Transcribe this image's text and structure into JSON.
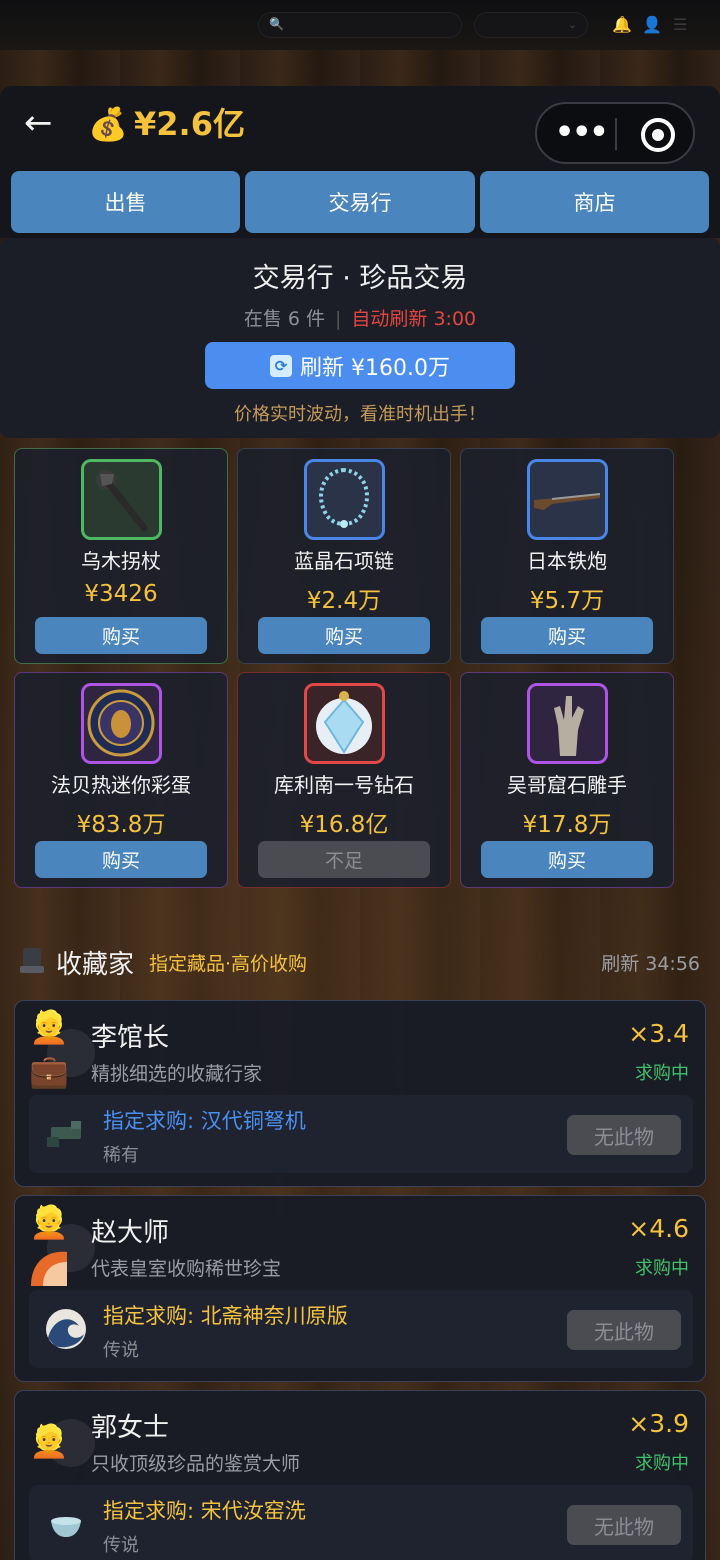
{
  "header": {
    "back_label": "←",
    "money_icon": "money-bag-icon",
    "money": "¥2.6亿"
  },
  "tabs": [
    {
      "label": "出售"
    },
    {
      "label": "交易行"
    },
    {
      "label": "商店"
    }
  ],
  "market": {
    "title": "交易行 · 珍品交易",
    "on_sale": "在售 6 件",
    "auto_refresh": "自动刷新 3:00",
    "refresh_label": "刷新 ¥160.0万",
    "tip": "价格实时波动，看准时机出手！"
  },
  "items": [
    {
      "name": "乌木拐杖",
      "price": "¥3426",
      "button": "购买",
      "rarity_color": "#4fb862",
      "icon": "cane-icon"
    },
    {
      "name": "蓝晶石项链",
      "price": "¥2.4万",
      "button": "购买",
      "rarity_color": "#4a86e8",
      "icon": "necklace-icon"
    },
    {
      "name": "日本铁炮",
      "price": "¥5.7万",
      "button": "购买",
      "rarity_color": "#4a86e8",
      "icon": "musket-icon"
    },
    {
      "name": "法贝热迷你彩蛋",
      "price": "¥83.8万",
      "button": "购买",
      "rarity_color": "#b054e8",
      "icon": "faberge-egg-icon"
    },
    {
      "name": "库利南一号钻石",
      "price": "¥16.8亿",
      "button": "不足",
      "rarity_color": "#e24848",
      "icon": "diamond-icon"
    },
    {
      "name": "吴哥窟石雕手",
      "price": "¥17.8万",
      "button": "购买",
      "rarity_color": "#b054e8",
      "icon": "stone-hand-icon"
    }
  ],
  "collectors_section": {
    "title": "收藏家",
    "tag": "指定藏品·高价收购",
    "refresh": "刷新 34:56"
  },
  "collectors": [
    {
      "name": "李馆长",
      "desc": "精挑细选的收藏行家",
      "multiplier": "×3.4",
      "status": "求购中",
      "want": "指定求购: 汉代铜弩机",
      "rarity": "稀有",
      "button": "无此物",
      "want_icon": "crossbow-icon"
    },
    {
      "name": "赵大师",
      "desc": "代表皇室收购稀世珍宝",
      "multiplier": "×4.6",
      "status": "求购中",
      "want": "指定求购: 北斋神奈川原版",
      "rarity": "传说",
      "button": "无此物",
      "want_icon": "great-wave-icon"
    },
    {
      "name": "郭女士",
      "desc": "只收顶级珍品的鉴赏大师",
      "multiplier": "×3.9",
      "status": "求购中",
      "want": "指定求购: 宋代汝窑洗",
      "rarity": "传说",
      "button": "无此物",
      "want_icon": "porcelain-bowl-icon"
    }
  ],
  "colors": {
    "accent_gold": "#f5c23d",
    "tab_blue": "#4a86bd",
    "refresh_blue": "#4b8ef0",
    "alert_red": "#e2463f",
    "status_green": "#3fc069"
  }
}
